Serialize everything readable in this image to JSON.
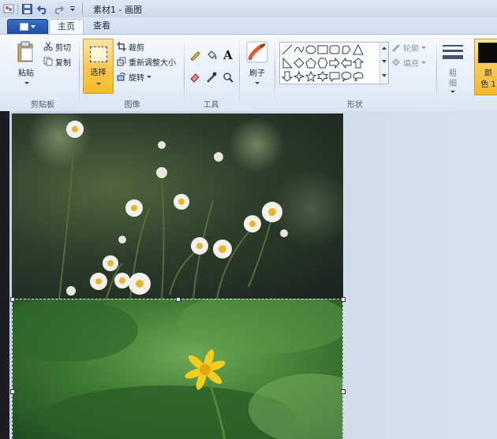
{
  "window": {
    "title": "素材1 - 画图"
  },
  "tabs": [
    {
      "label": "主页",
      "active": true
    },
    {
      "label": "查看",
      "active": false
    }
  ],
  "clipboard": {
    "group_label": "剪贴板",
    "paste": "粘贴",
    "cut": "剪切",
    "copy": "复制"
  },
  "image": {
    "group_label": "图像",
    "select": "选择",
    "crop": "裁剪",
    "resize": "重新调整大小",
    "rotate": "旋转"
  },
  "tools": {
    "group_label": "工具",
    "text_tool": "A"
  },
  "brushes": {
    "label": "刷子"
  },
  "shapes": {
    "group_label": "形状",
    "outline": "轮廓",
    "fill": "填充"
  },
  "size": {
    "label_line1": "粗",
    "label_line2": "细"
  },
  "colors": {
    "label_line1": "颜",
    "label_line2": "色 1",
    "color1": "#0b0b0b"
  },
  "accent_colors": {
    "selected_button": "#f9c74c",
    "file_button": "#1d4ea3",
    "ribbon": "#e4ecf6"
  }
}
